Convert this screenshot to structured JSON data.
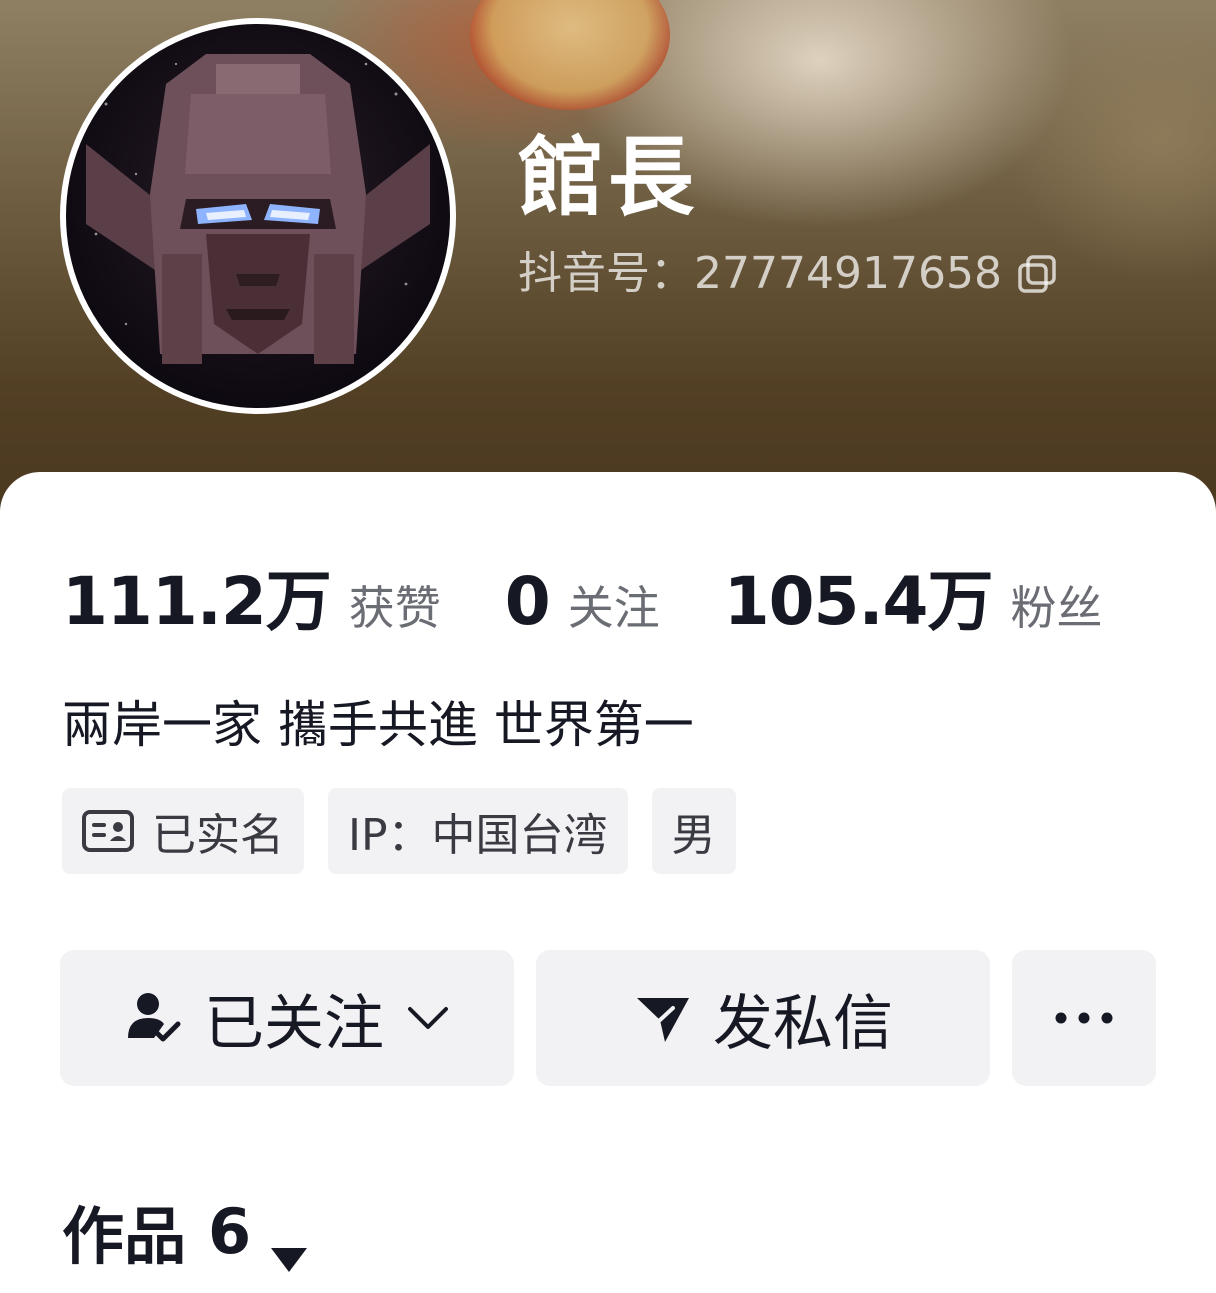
{
  "profile": {
    "name": "館長",
    "account_id": "抖音号：27774917658"
  },
  "stats": [
    {
      "value": "111.2万",
      "label": "获赞"
    },
    {
      "value": "0",
      "label": "关注"
    },
    {
      "value": "105.4万",
      "label": "粉丝"
    }
  ],
  "bio": "兩岸一家 攜手共進 世界第一",
  "tags": {
    "verified": "已实名",
    "ip": "IP：中国台湾",
    "gender": "男"
  },
  "actions": {
    "follow": "已关注",
    "message": "发私信"
  },
  "works": {
    "label": "作品",
    "count": "6"
  },
  "icons": {
    "copy": "copy-icon",
    "id_card": "id-card-icon",
    "follow_user": "user-check-icon",
    "dropdown": "chevron-down-icon",
    "send": "send-icon",
    "more": "more-dots-icon",
    "caret": "caret-down-icon"
  }
}
